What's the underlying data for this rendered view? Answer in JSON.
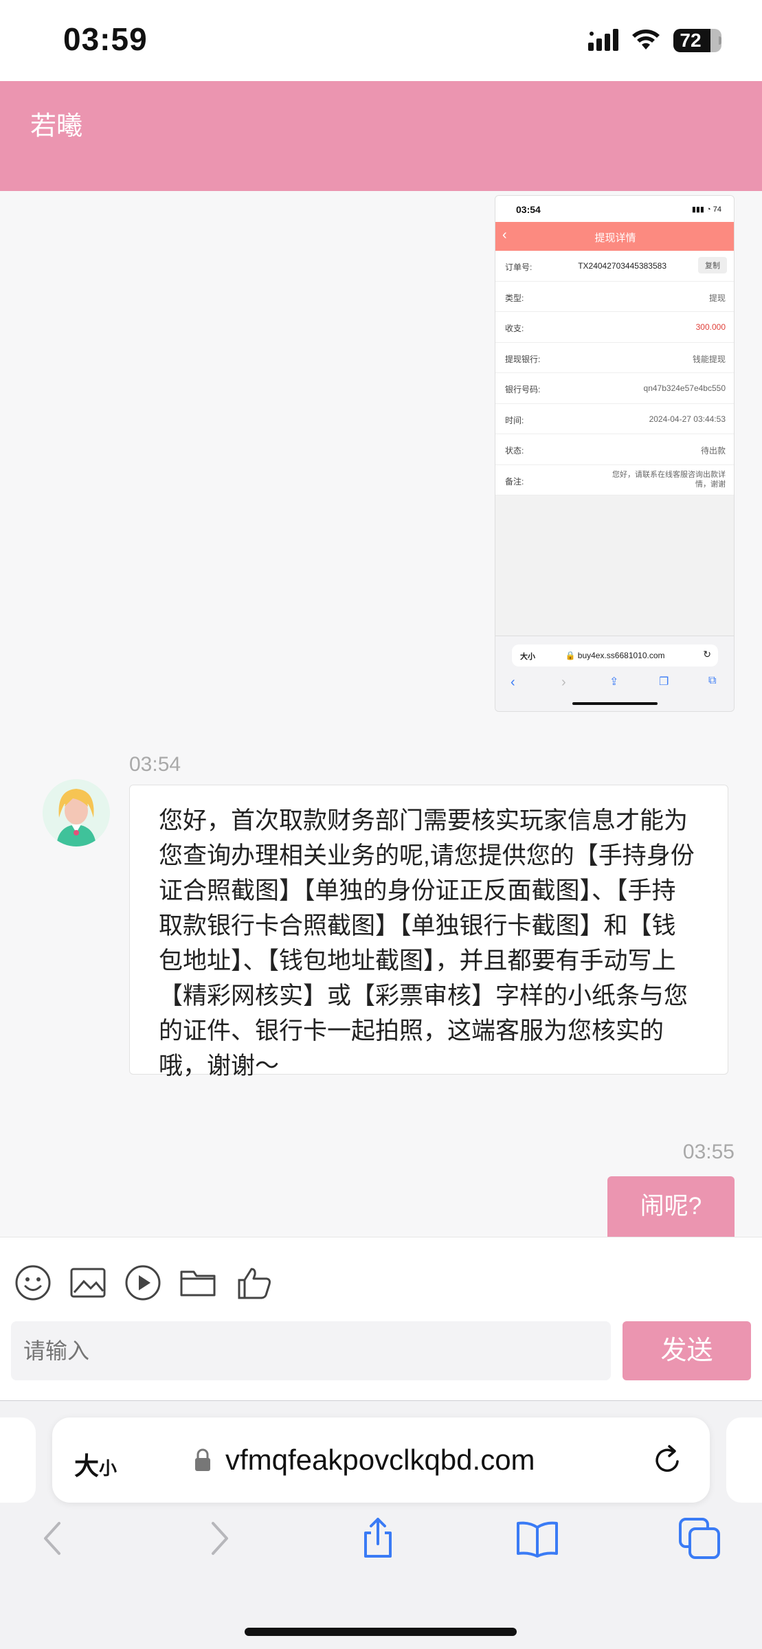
{
  "status_bar": {
    "time": "03:59",
    "battery": "72"
  },
  "header": {
    "title": "若曦"
  },
  "screenshot_image": {
    "time": "03:54",
    "battery": "74",
    "title": "提现详情",
    "order": {
      "label": "订单号:",
      "value": "TX24042703445383583",
      "copy": "复制"
    },
    "rows": [
      {
        "label": "类型:",
        "value": "提现"
      },
      {
        "label": "收支:",
        "value": "300.000"
      },
      {
        "label": "提现银行:",
        "value": "钱能提现"
      },
      {
        "label": "银行号码:",
        "value": "qn47b324e57e4bc550"
      },
      {
        "label": "时间:",
        "value": "2024-04-27 03:44:53"
      },
      {
        "label": "状态:",
        "value": "待出款"
      },
      {
        "label": "备注:",
        "value": "您好，请联系在线客服咨询出款详情，谢谢"
      }
    ],
    "url_size": "大小",
    "url": "buy4ex.ss6681010.com"
  },
  "messages": {
    "agent_time": "03:54",
    "agent_text": "您好，首次取款财务部门需要核实玩家信息才能为您查询办理相关业务的呢,请您提供您的【手持身份证合照截图】【单独的身份证正反面截图】、【手持取款银行卡合照截图】【单独银行卡截图】和【钱包地址】、【钱包地址截图】，并且都要有手动写上【精彩网核实】或【彩票审核】字样的小纸条与您的证件、银行卡一起拍照，这端客服为您核实的哦，谢谢～",
    "user_time": "03:55",
    "user_text": "闹呢?"
  },
  "composer": {
    "placeholder": "请输入",
    "send_label": "发送"
  },
  "browser": {
    "size_label_big": "大",
    "size_label_small": "小",
    "url": "vfmqfeakpovclkqbd.com"
  },
  "colors": {
    "brand_pink": "#eb95b0",
    "shot_nav": "#fc8a80",
    "link_blue": "#3a7bf5"
  }
}
